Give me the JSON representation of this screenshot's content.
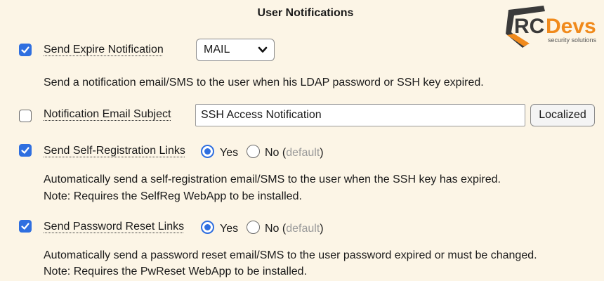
{
  "section": {
    "title": "User Notifications"
  },
  "logo": {
    "brand_rc": "RC",
    "brand_devs": "Devs",
    "tagline": "security solutions",
    "color_orange": "#f08a1c",
    "color_dark": "#3a3a3a"
  },
  "accent": "#2f6fe0",
  "expire": {
    "checked": true,
    "label": "Send Expire Notification",
    "select_value": "MAIL",
    "description": "Send a notification email/SMS to the user when his LDAP password or SSH key expired."
  },
  "email_subject": {
    "checked": false,
    "label": "Notification Email Subject",
    "value": "SSH Access Notification",
    "button": "Localized"
  },
  "selfreg": {
    "checked": true,
    "label": "Send Self-Registration Links",
    "yes": "Yes",
    "no": "No",
    "default_open": "(",
    "default_word": "default",
    "default_close": ")",
    "selected": "Yes",
    "description_1": "Automatically send a self-registration email/SMS to the user when the SSH key has expired.",
    "description_2": "Note: Requires the SelfReg WebApp to be installed."
  },
  "pwreset": {
    "checked": true,
    "label": "Send Password Reset Links",
    "yes": "Yes",
    "no": "No",
    "default_open": "(",
    "default_word": "default",
    "default_close": ")",
    "selected": "Yes",
    "description_1": "Automatically send a password reset email/SMS to the user password expired or must be changed.",
    "description_2": "Note: Requires the PwReset WebApp to be installed."
  }
}
